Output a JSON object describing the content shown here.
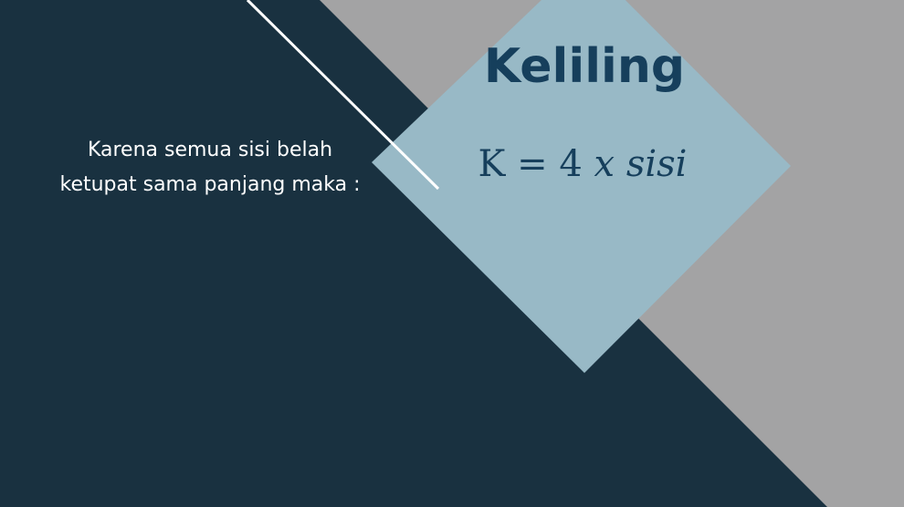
{
  "slide": {
    "title": "Keliling",
    "body_text": "Karena semua sisi belah ketupat sama panjang maka :",
    "formula": {
      "lhs": "K",
      "equals": "=",
      "number": "4",
      "times": "x",
      "variable": "sisi"
    }
  },
  "colors": {
    "dark_background": "#193140",
    "grey_background": "#a3a3a4",
    "diamond": "#98b9c6",
    "title_text": "#163f5c",
    "line": "#ffffff"
  }
}
